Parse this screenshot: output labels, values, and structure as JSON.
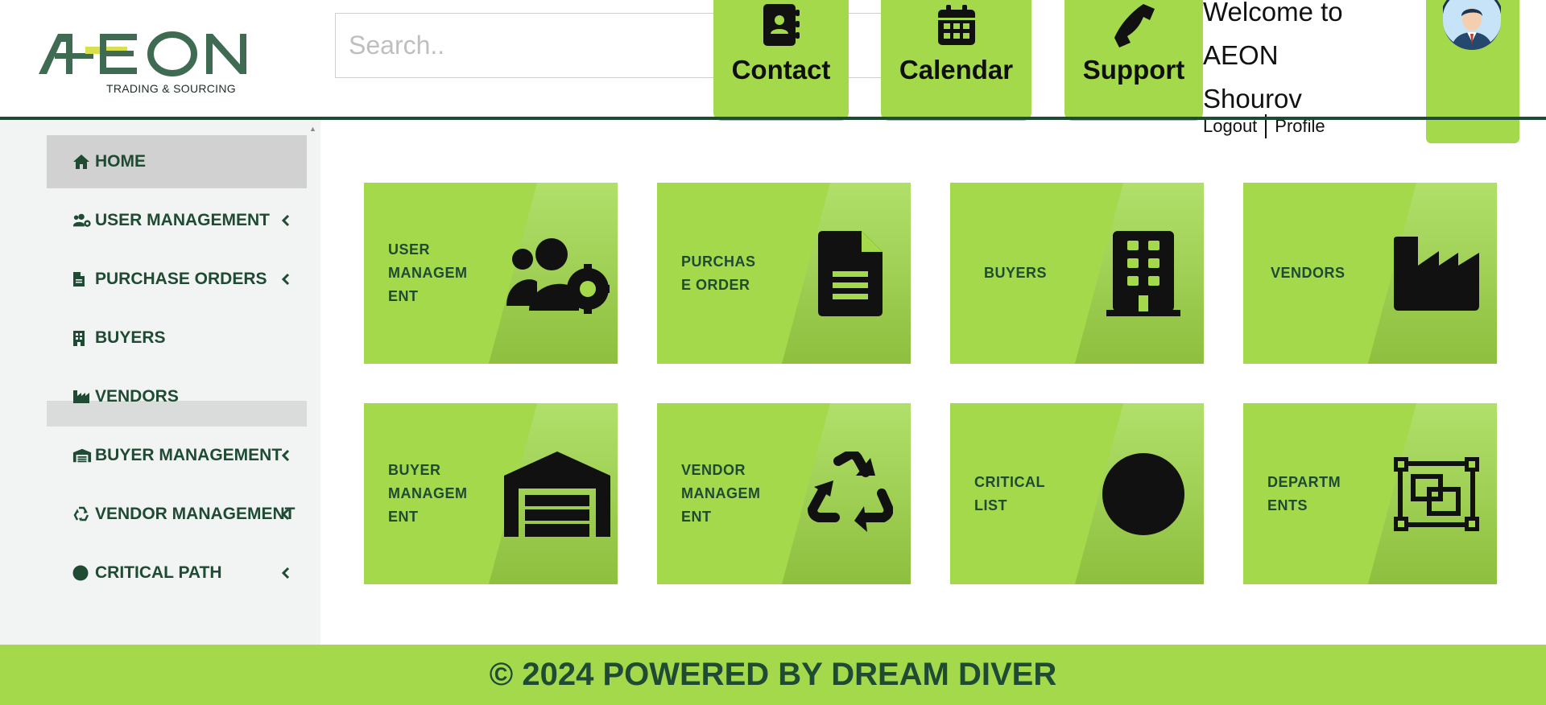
{
  "header": {
    "logo_text": "AEON",
    "logo_tagline": "TRADING & SOURCING",
    "search_placeholder": "Search..",
    "quick_links": [
      {
        "label": "Contact",
        "icon": "address-book-icon"
      },
      {
        "label": "Calendar",
        "icon": "calendar-icon"
      },
      {
        "label": "Support",
        "icon": "phone-icon"
      }
    ],
    "welcome_lines": [
      "Welcome to",
      "AEON",
      "Shourov"
    ],
    "logout_label": "Logout",
    "profile_label": "Profile",
    "avatar_icon": "user-avatar-icon"
  },
  "sidebar": {
    "items": [
      {
        "label": "HOME",
        "icon": "home-icon",
        "has_submenu": false,
        "active": true
      },
      {
        "label": "USER MANAGEMENT",
        "icon": "users-cog-icon",
        "has_submenu": true
      },
      {
        "label": "PURCHASE ORDERS",
        "icon": "file-icon",
        "has_submenu": true
      },
      {
        "label": "BUYERS",
        "icon": "building-icon",
        "has_submenu": false
      },
      {
        "label": "VENDORS",
        "icon": "industry-icon",
        "has_submenu": false
      },
      {
        "label": "BUYER MANAGEMENT",
        "icon": "warehouse-icon",
        "has_submenu": true
      },
      {
        "label": "VENDOR MANAGEMENT",
        "icon": "recycle-icon",
        "has_submenu": true
      },
      {
        "label": "CRITICAL PATH",
        "icon": "circle-icon",
        "has_submenu": true
      }
    ]
  },
  "tiles": [
    {
      "label": "USER\nMANAGEM\nENT",
      "icon": "users-cog-icon"
    },
    {
      "label": "PURCHAS\nE ORDER",
      "icon": "file-icon"
    },
    {
      "label": "BUYERS",
      "icon": "building-icon"
    },
    {
      "label": "VENDORS",
      "icon": "industry-icon"
    },
    {
      "label": "BUYER\nMANAGEM\nENT",
      "icon": "warehouse-icon"
    },
    {
      "label": "VENDOR\nMANAGEM\nENT",
      "icon": "recycle-icon"
    },
    {
      "label": "CRITICAL\nLIST",
      "icon": "circle-icon"
    },
    {
      "label": "DEPARTM\nENTS",
      "icon": "object-group-icon"
    }
  ],
  "footer": {
    "text": "© 2024 POWERED BY DREAM DIVER"
  },
  "colors": {
    "accent_green": "#a3d94b",
    "dark_green": "#1f4a33",
    "sidebar_bg": "#f2f4f3",
    "active_item_bg": "#d1d1d1"
  }
}
